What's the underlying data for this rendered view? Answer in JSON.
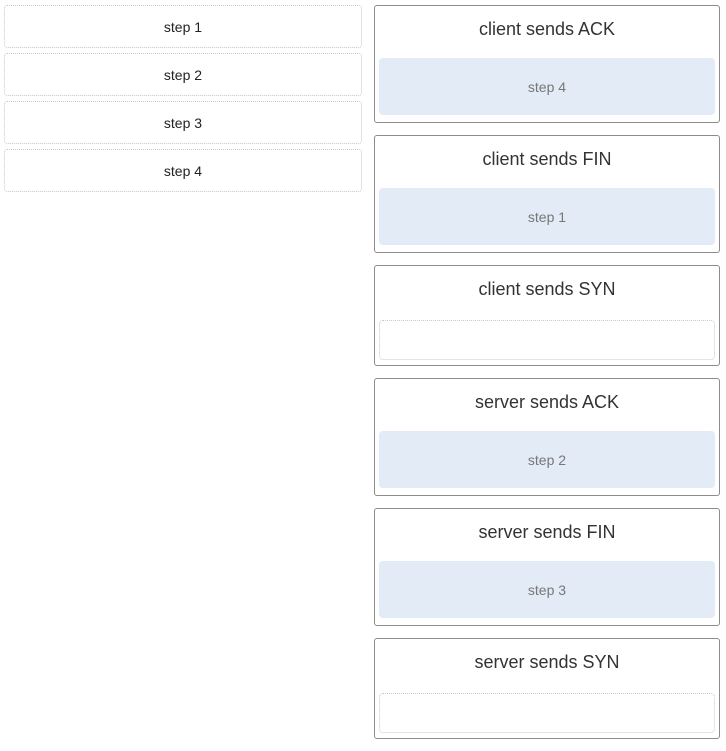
{
  "source_items": [
    {
      "label": "step 1"
    },
    {
      "label": "step 2"
    },
    {
      "label": "step 3"
    },
    {
      "label": "step 4"
    }
  ],
  "targets": [
    {
      "title": "client sends ACK",
      "answer": "step 4"
    },
    {
      "title": "client sends FIN",
      "answer": "step 1"
    },
    {
      "title": "client sends SYN",
      "answer": ""
    },
    {
      "title": "server sends ACK",
      "answer": "step 2"
    },
    {
      "title": "server sends FIN",
      "answer": "step 3"
    },
    {
      "title": "server sends SYN",
      "answer": ""
    }
  ],
  "colors": {
    "slot_filled_bg": "#e3ebf7",
    "target_border": "#8c8c8c",
    "source_border": "#c8c8c8"
  }
}
